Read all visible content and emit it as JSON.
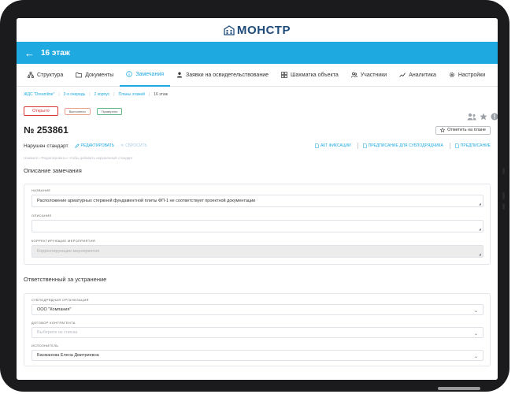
{
  "app": {
    "logo_text": "МОНСТР",
    "page_title": "16 этаж"
  },
  "tabs": [
    {
      "label": "Структура",
      "icon": "structure-icon",
      "active": false
    },
    {
      "label": "Документы",
      "icon": "folder-icon",
      "active": false
    },
    {
      "label": "Замечания",
      "icon": "info-icon",
      "active": true
    },
    {
      "label": "Заявки на освидетельствование",
      "icon": "person-icon",
      "active": false
    },
    {
      "label": "Шахматка объекта",
      "icon": "grid-icon",
      "active": false
    },
    {
      "label": "Участники",
      "icon": "participants-icon",
      "active": false
    },
    {
      "label": "Аналитика",
      "icon": "analytics-icon",
      "active": false
    },
    {
      "label": "Настройки",
      "icon": "gear-icon",
      "active": false
    }
  ],
  "breadcrumb": [
    "ЖДС \"Dreamline\"",
    "2-я очередь",
    "2 корпус",
    "Планы этажей",
    "16 этаж"
  ],
  "statuses": {
    "open": "Открыто",
    "done": "Выполнено",
    "accepted": "Проверено"
  },
  "remark": {
    "number": "№ 253861",
    "mark_on_plan": "Отметить на плане",
    "violation": "Нарушен стандарт",
    "edit": "РЕДАКТИРОВАТЬ",
    "reset": "СБРОСИТЬ",
    "act": "АКТ ФИКСАЦИИ",
    "sub_order": "ПРЕДПИСАНИЕ ДЛЯ СУБПОДРЯДЧИКА",
    "order": "ПРЕДПИСАНИЕ",
    "hint": "Нажмите «Редактировать» чтобы добавить нарушенный стандарт"
  },
  "description_section": {
    "title": "Описание замечания",
    "name_label": "НАЗВАНИЕ",
    "name_value": "Расположение арматурных стержней фундаментной плиты ФП-1 не соответствует проектной документации",
    "desc_label": "ОПИСАНИЕ",
    "desc_value": "",
    "corrective_label": "КОРРЕКТИРУЮЩИЕ МЕРОПРИЯТИЯ",
    "corrective_placeholder": "Корректирующие мероприятия"
  },
  "responsible_section": {
    "title": "Ответственный за устранение",
    "org_label": "СУБПОДРЯДНАЯ ОРГАНИЗАЦИЯ",
    "org_value": "ООО \"Компания\"",
    "contract_label": "ДОГОВОР КОНТРАГЕНТА",
    "contract_placeholder": "Выберите из списка",
    "executor_label": "ИСПОЛНИТЕЛЬ",
    "executor_value": "Басманова Елена Дмитриевна"
  },
  "colors": {
    "accent": "#1ea9e1",
    "open": "#d9383a",
    "done": "#e8a08f",
    "accepted": "#5fb983",
    "logo": "#1e4b7a"
  }
}
